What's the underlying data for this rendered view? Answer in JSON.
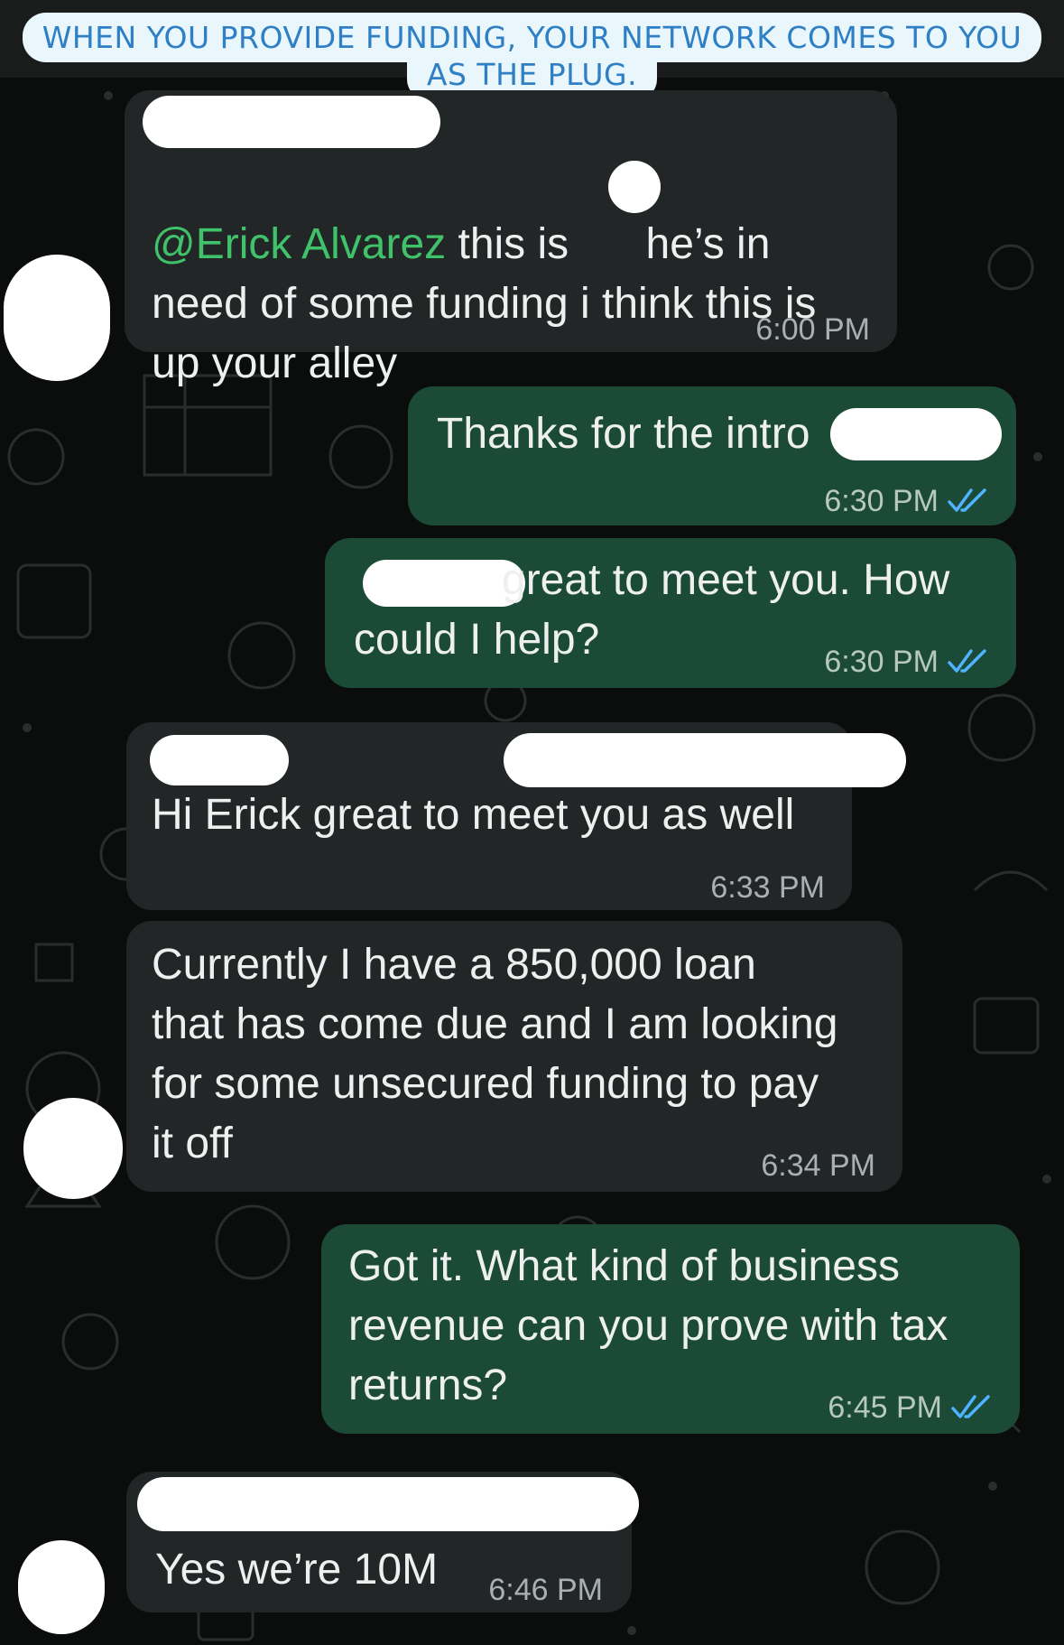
{
  "banner": {
    "line1": "WHEN YOU PROVIDE FUNDING, YOUR NETWORK COMES TO YOU",
    "line2": "AS THE PLUG."
  },
  "messages": [
    {
      "mention": "@Erick Alvarez",
      "text_a": " this is ",
      "text_b": "he’s in\nneed of some funding i think this is\nup your alley",
      "time": "6:00 PM"
    },
    {
      "text": "Thanks for the intro",
      "time": "6:30 PM"
    },
    {
      "text_a": "great to meet you. How",
      "text_b": "could I help?",
      "time": "6:30 PM"
    },
    {
      "text": "Hi Erick great to meet you as well",
      "time": "6:33 PM"
    },
    {
      "text": "Currently I have a 850,000 loan\nthat has come due and I am looking\nfor some unsecured funding to pay\nit off",
      "time": "6:34 PM"
    },
    {
      "text": "Got it. What kind of business\nrevenue can you prove with tax\nreturns?",
      "time": "6:45 PM"
    },
    {
      "text": "Yes we’re 10M",
      "time": "6:46 PM"
    }
  ],
  "colors": {
    "incoming_bubble": "#232627",
    "outgoing_bubble": "#1b4a36",
    "mention": "#3fc26a",
    "read_ticks": "#4fb3ff",
    "banner_text": "#2e7fc4",
    "banner_bg": "#e9f6fb"
  }
}
